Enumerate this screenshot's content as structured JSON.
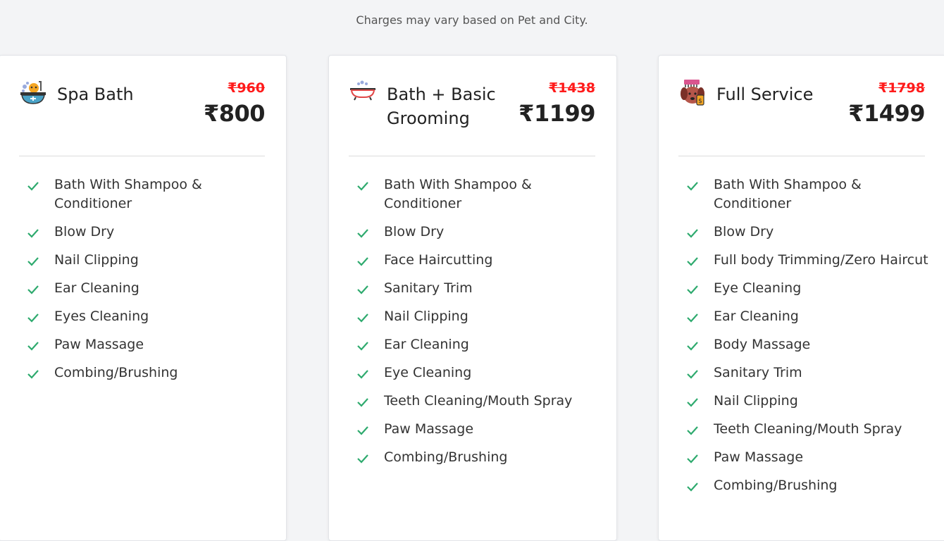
{
  "note": "Charges may vary based on Pet and City.",
  "colors": {
    "check": "#2eaa6e",
    "old_price": "#ff1a1a"
  },
  "plans": [
    {
      "icon": "pet-bathtub-icon",
      "title": "Spa Bath",
      "old_price": "₹960",
      "price": "₹800",
      "features": [
        "Bath With Shampoo & Conditioner",
        "Blow Dry",
        "Nail Clipping",
        "Ear Cleaning",
        "Eyes Cleaning",
        "Paw Massage",
        "Combing/Brushing"
      ]
    },
    {
      "icon": "bathtub-icon",
      "title": "Bath + Basic Grooming",
      "old_price": "₹1438",
      "price": "₹1199",
      "features": [
        "Bath With Shampoo & Conditioner",
        "Blow Dry",
        "Face Haircutting",
        "Sanitary Trim",
        "Nail Clipping",
        "Ear Cleaning",
        "Eye Cleaning",
        "Teeth Cleaning/Mouth Spray",
        "Paw Massage",
        "Combing/Brushing"
      ]
    },
    {
      "icon": "dog-grooming-icon",
      "title": "Full Service",
      "old_price": "₹1798",
      "price": "₹1499",
      "features": [
        "Bath With Shampoo & Conditioner",
        "Blow Dry",
        "Full body Trimming/Zero Haircut",
        "Eye Cleaning",
        "Ear Cleaning",
        "Body Massage",
        "Sanitary Trim",
        "Nail Clipping",
        "Teeth Cleaning/Mouth Spray",
        "Paw Massage",
        "Combing/Brushing"
      ]
    }
  ]
}
